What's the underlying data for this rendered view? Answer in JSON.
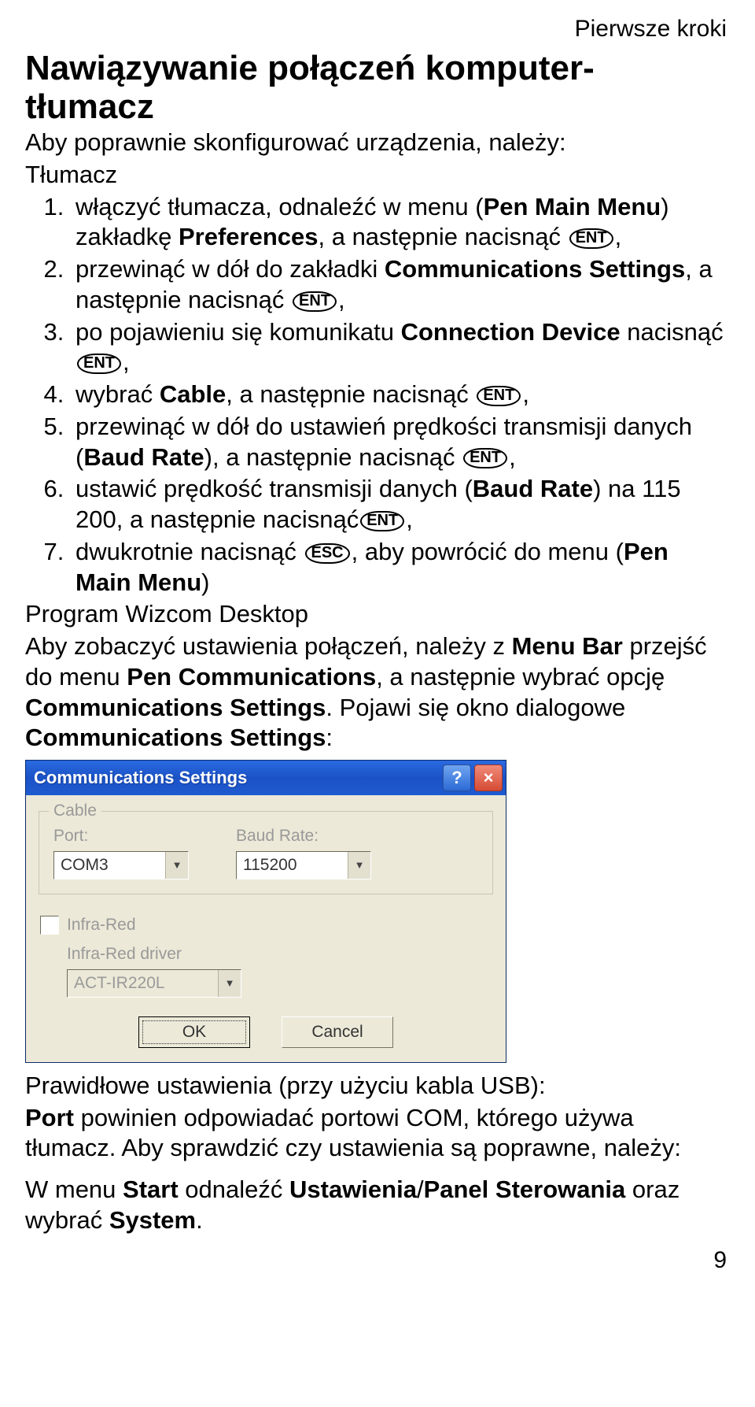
{
  "header": "Pierwsze kroki",
  "h1_line1": "Nawiązywanie połączeń komputer-",
  "h1_line2": "tłumacz",
  "intro1": "Aby poprawnie skonfigurować urządzenia, należy:",
  "intro2": "Tłumacz",
  "steps": {
    "s1a": "włączyć tłumacza, odnaleźć w menu (",
    "s1b": "Pen Main Menu",
    "s1c": ") zakładkę ",
    "s1d": "Preferences",
    "s1e": ", a następnie nacisnąć ",
    "s2a": "przewinąć w dół do zakładki ",
    "s2b": "Communications Settings",
    "s2c": ", a następnie nacisnąć ",
    "s3a": "po pojawieniu się komunikatu ",
    "s3b": "Connection Device",
    "s3c": " nacisnąć ",
    "s4a": "wybrać ",
    "s4b": "Cable",
    "s4c": ", a następnie nacisnąć ",
    "s5a": "przewinąć w dół do ustawień prędkości transmisji danych (",
    "s5b": "Baud Rate",
    "s5c": "), a następnie nacisnąć ",
    "s6a": "ustawić prędkość transmisji danych (",
    "s6b": "Baud Rate",
    "s6c": ") na 115 200, a następnie nacisnąć",
    "s7a": "dwukrotnie nacisnąć ",
    "s7b": ", aby powrócić do menu (",
    "s7c": "Pen Main Menu",
    "s7d": ")"
  },
  "prog_heading": "Program Wizcom Desktop",
  "prog_p1a": "Aby zobaczyć ustawienia połączeń, należy z ",
  "prog_p1b": "Menu Bar",
  "prog_p1c": " przejść do menu ",
  "prog_p1d": "Pen Communications",
  "prog_p1e": ", a następnie wybrać opcję ",
  "prog_p1f": "Communications Settings",
  "prog_p1g": ". Pojawi się okno dialogowe ",
  "prog_p1h": "Communications Settings",
  "prog_p1i": ":",
  "dialog": {
    "title": "Communications Settings",
    "help_glyph": "?",
    "close_glyph": "×",
    "cable_legend": "Cable",
    "port_label": "Port:",
    "port_value": "COM3",
    "baud_label": "Baud Rate:",
    "baud_value": "115200",
    "infra_label": "Infra-Red",
    "infra_driver_label": "Infra-Red driver",
    "infra_driver_value": "ACT-IR220L",
    "ok": "OK",
    "cancel": "Cancel",
    "arrow": "▼"
  },
  "after1a": "Prawidłowe ustawienia (przy użyciu kabla USB):",
  "after2a": "Port",
  "after2b": " powinien odpowiadać portowi COM, którego używa tłumacz. Aby sprawdzić czy ustawienia są poprawne, należy:",
  "after3a": "W menu ",
  "after3b": "Start",
  "after3c": " odnaleźć ",
  "after3d": "Ustawienia",
  "after3e": "/",
  "after3f": "Panel Sterowania",
  "after3g": " oraz wybrać ",
  "after3h": "System",
  "after3i": ".",
  "key_ent": "ENT",
  "key_esc": "ESC",
  "comma": ",",
  "page_number": "9"
}
